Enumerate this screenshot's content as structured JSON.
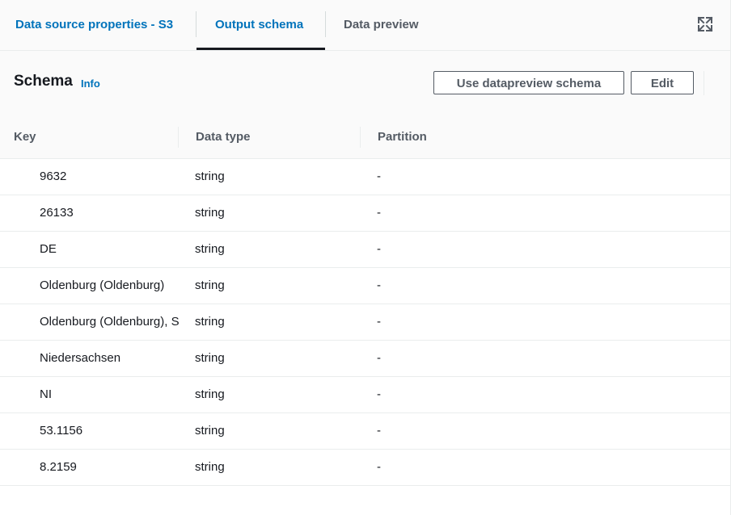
{
  "tabs": [
    {
      "label": "Data source properties - S3"
    },
    {
      "label": "Output schema"
    },
    {
      "label": "Data preview"
    }
  ],
  "header": {
    "title": "Schema",
    "info_label": "Info",
    "use_preview_label": "Use datapreview schema",
    "edit_label": "Edit"
  },
  "table": {
    "columns": [
      "Key",
      "Data type",
      "Partition"
    ],
    "rows": [
      {
        "key": "9632",
        "type": "string",
        "partition": "-"
      },
      {
        "key": "26133",
        "type": "string",
        "partition": "-"
      },
      {
        "key": "DE",
        "type": "string",
        "partition": "-"
      },
      {
        "key": "Oldenburg (Oldenburg)",
        "type": "string",
        "partition": "-"
      },
      {
        "key": "Oldenburg (Oldenburg), Stadt",
        "type": "string",
        "partition": "-"
      },
      {
        "key": "Niedersachsen",
        "type": "string",
        "partition": "-"
      },
      {
        "key": "NI",
        "type": "string",
        "partition": "-"
      },
      {
        "key": "53.1156",
        "type": "string",
        "partition": "-"
      },
      {
        "key": "8.2159",
        "type": "string",
        "partition": "-"
      }
    ]
  },
  "colors": {
    "link": "#0073bb",
    "text": "#16191f",
    "muted": "#545b64",
    "border": "#eaeded"
  },
  "icons": {
    "expand": "expand-icon"
  }
}
